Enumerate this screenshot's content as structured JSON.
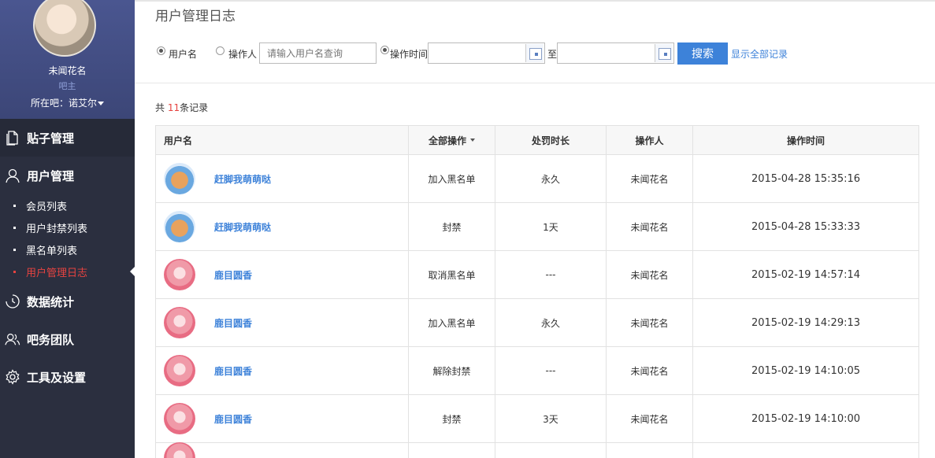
{
  "profile": {
    "name": "未闻花名",
    "role": "吧主",
    "forum_label": "所在吧：",
    "forum_name": "诺艾尔"
  },
  "nav": {
    "posts": "贴子管理",
    "users": "用户管理",
    "stats": "数据统计",
    "team": "吧务团队",
    "tools": "工具及设置"
  },
  "subnav": [
    {
      "label": "会员列表",
      "active": false
    },
    {
      "label": "用户封禁列表",
      "active": false
    },
    {
      "label": "黑名单列表",
      "active": false
    },
    {
      "label": "用户管理日志",
      "active": true
    }
  ],
  "page": {
    "title": "用户管理日志"
  },
  "filter": {
    "radio_username": "用户名",
    "radio_operator": "操作人",
    "input_placeholder": "请输入用户名查询",
    "radio_time": "操作时间",
    "to_label": "至",
    "search_button": "搜索",
    "show_all": "显示全部记录"
  },
  "summary": {
    "prefix": "共 ",
    "count": "11",
    "suffix": "条记录"
  },
  "table": {
    "headers": {
      "user": "用户名",
      "op": "全部操作",
      "duration": "处罚时长",
      "operator": "操作人",
      "time": "操作时间"
    },
    "rows": [
      {
        "avatar": "bear",
        "user": "赶脚我萌萌哒",
        "op": "加入黑名单",
        "duration": "永久",
        "operator": "未闻花名",
        "time": "2015-04-28 15:35:16"
      },
      {
        "avatar": "bear",
        "user": "赶脚我萌萌哒",
        "op": "封禁",
        "duration": "1天",
        "operator": "未闻花名",
        "time": "2015-04-28 15:33:33"
      },
      {
        "avatar": "pink",
        "user": "鹿目圆香",
        "op": "取消黑名单",
        "duration": "---",
        "operator": "未闻花名",
        "time": "2015-02-19 14:57:14"
      },
      {
        "avatar": "pink",
        "user": "鹿目圆香",
        "op": "加入黑名单",
        "duration": "永久",
        "operator": "未闻花名",
        "time": "2015-02-19 14:29:13"
      },
      {
        "avatar": "pink",
        "user": "鹿目圆香",
        "op": "解除封禁",
        "duration": "---",
        "operator": "未闻花名",
        "time": "2015-02-19 14:10:05"
      },
      {
        "avatar": "pink",
        "user": "鹿目圆香",
        "op": "封禁",
        "duration": "3天",
        "operator": "未闻花名",
        "time": "2015-02-19 14:10:00"
      }
    ]
  },
  "colors": {
    "sidebar_bg": "#2b2f3f",
    "accent_blue": "#3d82d9",
    "active_red": "#e64340"
  }
}
